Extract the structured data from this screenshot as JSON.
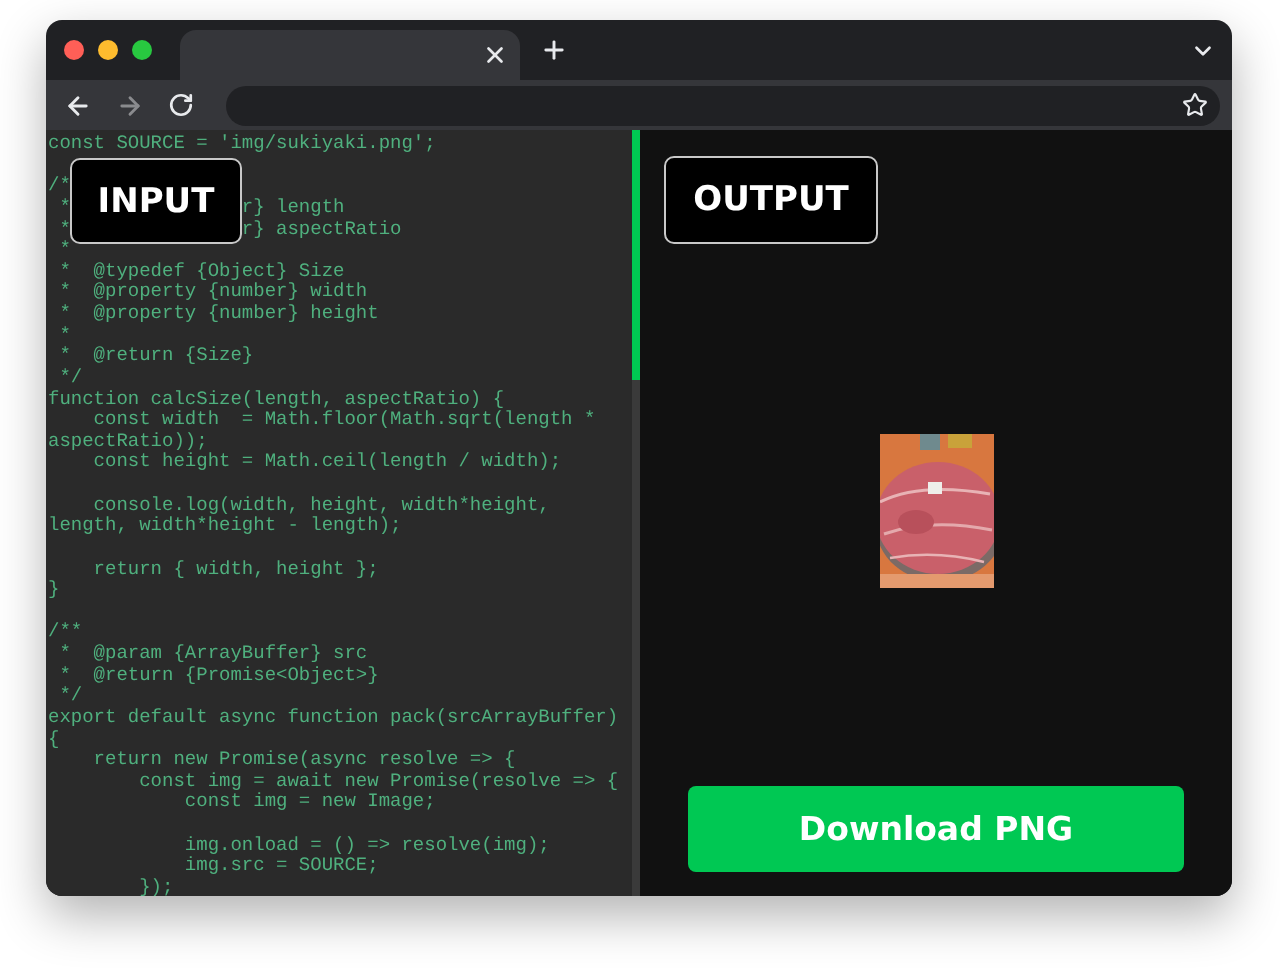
{
  "editor": {
    "badge": "INPUT",
    "lines": [
      {
        "text": "const SOURCE = 'img/sukiyaki.png';",
        "space_above": false
      },
      {
        "before": "/*",
        "space_above": true
      },
      {
        "before": " *",
        "after": "r} length",
        "space_above": false
      },
      {
        "before": " *",
        "after": "r} aspectRatio",
        "space_above": false
      },
      {
        "text": " *",
        "space_above": false
      },
      {
        "text": " *  @typedef {Object} Size",
        "space_above": false
      },
      {
        "text": " *  @property {number} width",
        "space_above": false
      },
      {
        "text": " *  @property {number} height",
        "space_above": false
      },
      {
        "text": " *",
        "space_above": false
      },
      {
        "text": " *  @return {Size}",
        "space_above": false
      },
      {
        "text": " */",
        "space_above": false
      },
      {
        "text": "function calcSize(length, aspectRatio) {",
        "space_above": false
      },
      {
        "text": "    const width  = Math.floor(Math.sqrt(length *",
        "space_above": false
      },
      {
        "text": "aspectRatio));",
        "space_above": false
      },
      {
        "text": "    const height = Math.ceil(length / width);",
        "space_above": false
      },
      {
        "text": "    console.log(width, height, width*height,",
        "space_above": true
      },
      {
        "text": "length, width*height - length);",
        "space_above": false
      },
      {
        "text": "    return { width, height };",
        "space_above": true
      },
      {
        "text": "}",
        "space_above": false
      },
      {
        "text": "/**",
        "space_above": true
      },
      {
        "text": " *  @param {ArrayBuffer} src",
        "space_above": false
      },
      {
        "text": " *  @return {Promise<Object>}",
        "space_above": false
      },
      {
        "text": " */",
        "space_above": false
      },
      {
        "text": "export default async function pack(srcArrayBuffer)",
        "space_above": false
      },
      {
        "text": "{",
        "space_above": false
      },
      {
        "text": "    return new Promise(async resolve => {",
        "space_above": false
      },
      {
        "text": "        const img = await new Promise(resolve => {",
        "space_above": false
      },
      {
        "text": "            const img = new Image;",
        "space_above": false
      },
      {
        "text": "            img.onload = () => resolve(img);",
        "space_above": true
      },
      {
        "text": "            img.src = SOURCE;",
        "space_above": false
      },
      {
        "text": "        });",
        "space_above": false
      }
    ]
  },
  "output": {
    "badge": "OUTPUT",
    "button": "Download PNG"
  }
}
